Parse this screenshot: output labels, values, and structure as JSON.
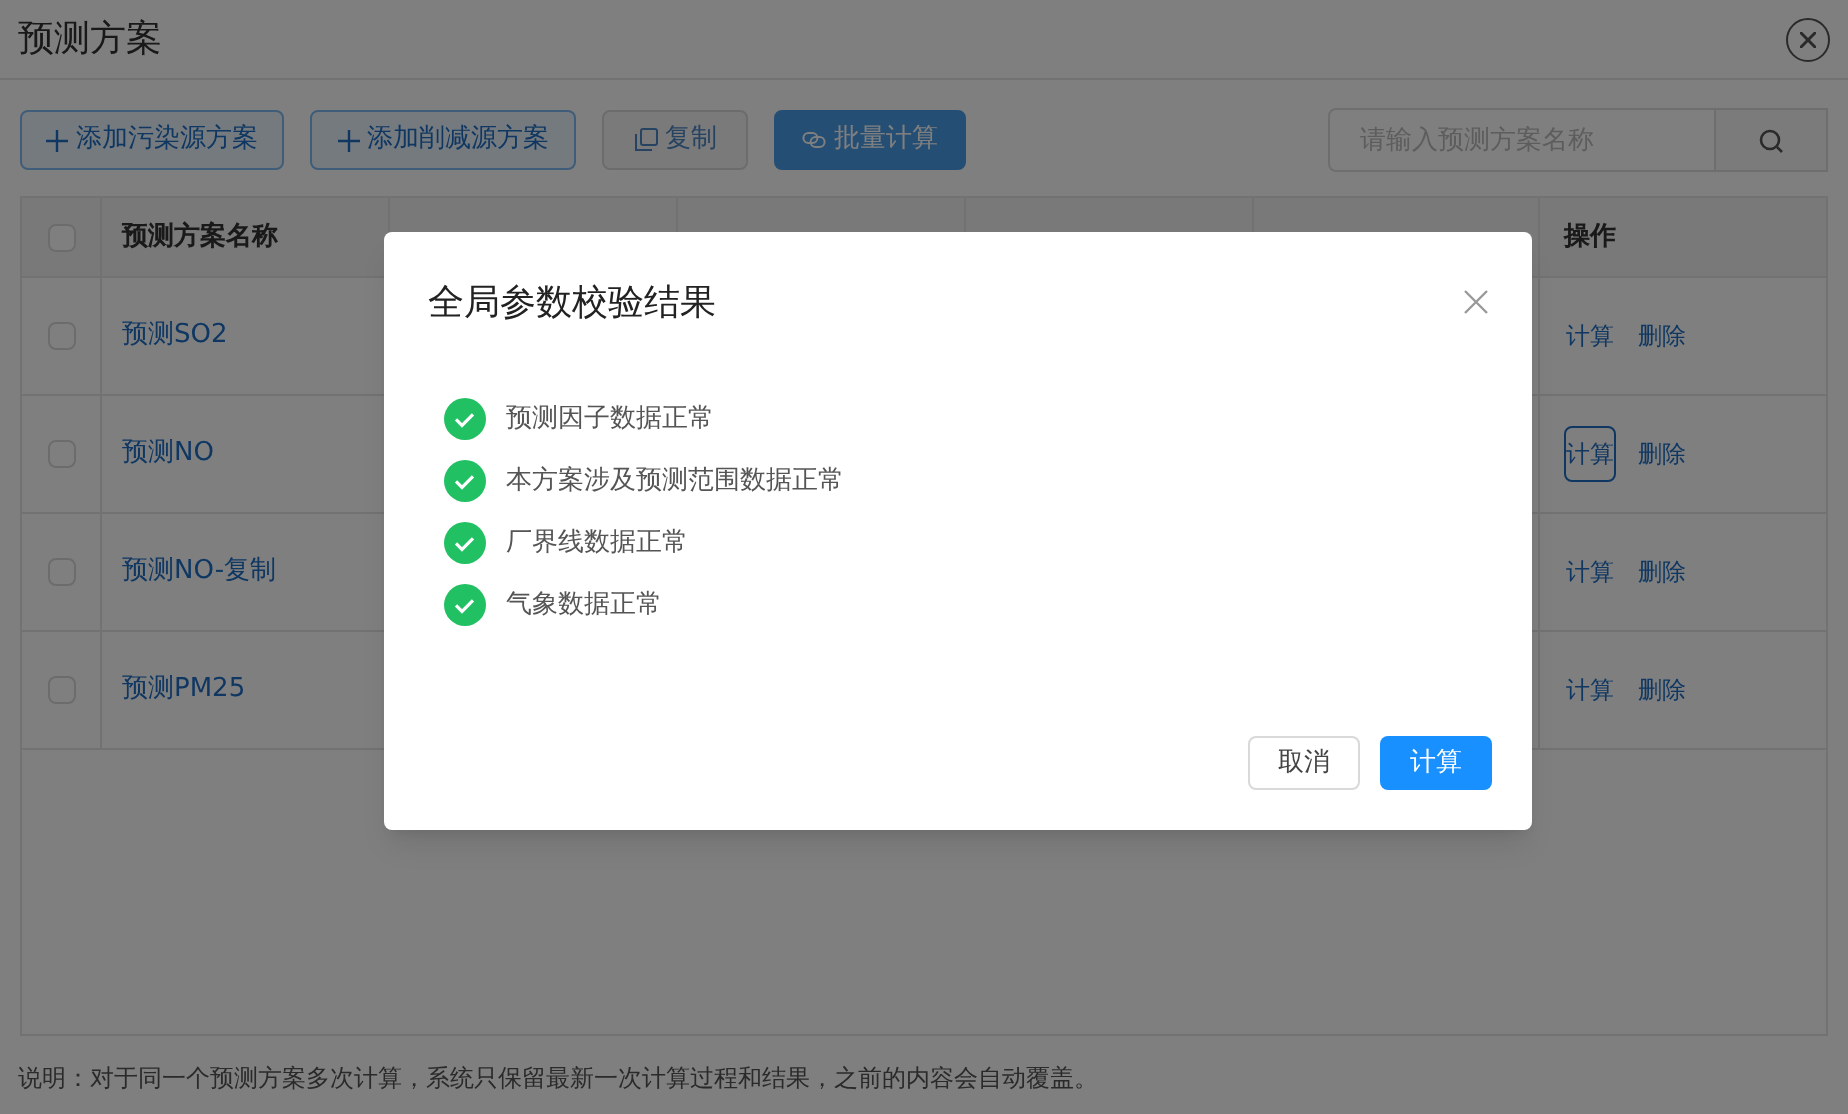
{
  "page": {
    "title": "预测方案"
  },
  "toolbar": {
    "buttons": [
      {
        "label": "添加污染源方案",
        "kind": "add",
        "disabled": false
      },
      {
        "label": "添加削减源方案",
        "kind": "add",
        "disabled": false
      },
      {
        "label": "复制",
        "kind": "copy",
        "disabled": true
      },
      {
        "label": "批量计算",
        "kind": "primary",
        "disabled": true
      }
    ],
    "search": {
      "placeholder": "请输入预测方案名称"
    }
  },
  "table": {
    "select_all": {
      "checked": false
    },
    "columns": [
      "预测方案名称",
      "操作"
    ],
    "rows": [
      {
        "checked": false,
        "name": "预测SO2",
        "actions": [
          {
            "label": "计算",
            "focused": false
          },
          {
            "label": "删除",
            "focused": false
          }
        ]
      },
      {
        "checked": false,
        "name": "预测NO",
        "actions": [
          {
            "label": "计算",
            "focused": true
          },
          {
            "label": "删除",
            "focused": false
          }
        ]
      },
      {
        "checked": false,
        "name": "预测NO-复制",
        "actions": [
          {
            "label": "计算",
            "focused": false
          },
          {
            "label": "删除",
            "focused": false
          }
        ]
      },
      {
        "checked": false,
        "name": "预测PM25",
        "actions": [
          {
            "label": "计算",
            "focused": false
          },
          {
            "label": "删除",
            "focused": false
          }
        ]
      }
    ]
  },
  "note": "说明：对于同一个预测方案多次计算，系统只保留最新一次计算过程和结果，之前的内容会自动覆盖。",
  "dialog": {
    "title": "全局参数校验结果",
    "checks": [
      {
        "text": "预测因子数据正常",
        "passed": true
      },
      {
        "text": "本方案涉及预测范围数据正常",
        "passed": true
      },
      {
        "text": "厂界线数据正常",
        "passed": true
      },
      {
        "text": "气象数据正常",
        "passed": true
      }
    ],
    "buttons": [
      {
        "label": "取消",
        "kind": "default"
      },
      {
        "label": "计算",
        "kind": "primary"
      }
    ]
  }
}
